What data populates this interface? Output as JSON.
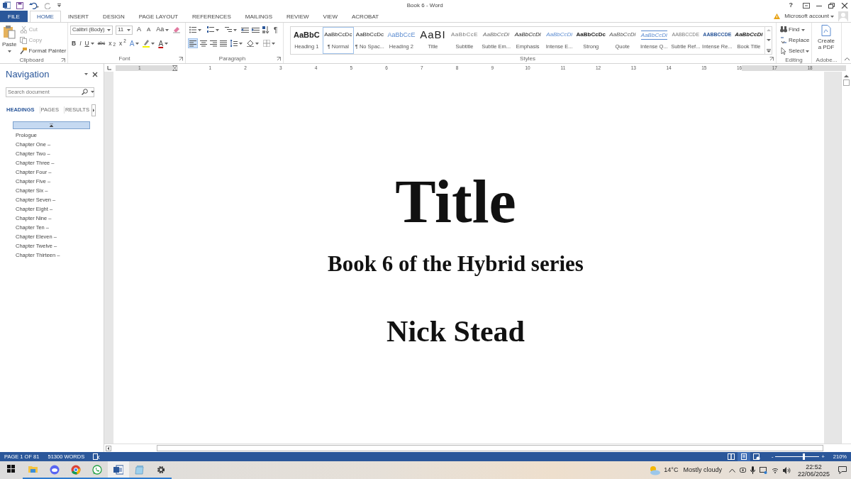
{
  "title_bar": {
    "title": "Book 6 - Word",
    "help": "?"
  },
  "account": {
    "label": "Microsoft account"
  },
  "tabs": [
    {
      "label": "FILE",
      "kind": "backstage",
      "selected": false
    },
    {
      "label": "HOME",
      "kind": "tab",
      "selected": true
    },
    {
      "label": "INSERT",
      "kind": "tab",
      "selected": false
    },
    {
      "label": "DESIGN",
      "kind": "tab",
      "selected": false
    },
    {
      "label": "PAGE LAYOUT",
      "kind": "tab",
      "selected": false
    },
    {
      "label": "REFERENCES",
      "kind": "tab",
      "selected": false
    },
    {
      "label": "MAILINGS",
      "kind": "tab",
      "selected": false
    },
    {
      "label": "REVIEW",
      "kind": "tab",
      "selected": false
    },
    {
      "label": "VIEW",
      "kind": "tab",
      "selected": false
    },
    {
      "label": "ACROBAT",
      "kind": "tab",
      "selected": false
    }
  ],
  "clipboard": {
    "paste": "Paste",
    "group": "Clipboard",
    "items": [
      {
        "kind": "cut",
        "label": "Cut",
        "disabled": true
      },
      {
        "kind": "copy",
        "label": "Copy",
        "disabled": true
      },
      {
        "kind": "painter",
        "label": "Format Painter",
        "disabled": false
      }
    ]
  },
  "font": {
    "name": "Calibri (Body)",
    "size": "11",
    "grow": "A",
    "shrink": "A",
    "case": "Aa",
    "format_buttons": [
      "B",
      "I",
      "U",
      "abc",
      "x$_{2}$",
      "x$^{2}$"
    ],
    "effects": "A",
    "font_color_label": "A",
    "group": "Font"
  },
  "paragraph": {
    "show_marks": "¶",
    "group": "Paragraph",
    "alignment": [
      {
        "kind": "left",
        "selected": true
      },
      {
        "kind": "center",
        "selected": false
      },
      {
        "kind": "right",
        "selected": false
      },
      {
        "kind": "justify",
        "selected": false
      }
    ]
  },
  "styles": {
    "group": "Styles",
    "items": [
      {
        "preview": "AaBbC",
        "label": "Heading 1",
        "kind": "heading1",
        "selected": false
      },
      {
        "preview": "AaBbCcDc",
        "label": "¶ Normal",
        "kind": "normal",
        "selected": true
      },
      {
        "preview": "AaBbCcDc",
        "label": "¶ No Spac...",
        "kind": "normal",
        "selected": false
      },
      {
        "preview": "AaBbCcE",
        "label": "Heading 2",
        "kind": "heading2",
        "selected": false
      },
      {
        "preview": "AaBI",
        "label": "Title",
        "kind": "title",
        "selected": false
      },
      {
        "preview": "AaBbCcE",
        "label": "Subtitle",
        "kind": "subtitle",
        "selected": false
      },
      {
        "preview": "AaBbCcDi",
        "label": "Subtle Em...",
        "kind": "subtle",
        "selected": false
      },
      {
        "preview": "AaBbCcDi",
        "label": "Emphasis",
        "kind": "emphasis",
        "selected": false
      },
      {
        "preview": "AaBbCcDi",
        "label": "Intense E...",
        "kind": "intense",
        "selected": false
      },
      {
        "preview": "AaBbCcDc",
        "label": "Strong",
        "kind": "strong",
        "selected": false
      },
      {
        "preview": "AaBbCcDi",
        "label": "Quote",
        "kind": "quote",
        "selected": false
      },
      {
        "preview": "AaBbCcDi",
        "label": "Intense Q...",
        "kind": "intensequote",
        "selected": false
      },
      {
        "preview": "AABBCCDE",
        "label": "Subtle Ref...",
        "kind": "subtleref",
        "selected": false
      },
      {
        "preview": "AABBCCDE",
        "label": "Intense Re...",
        "kind": "intenseref",
        "selected": false
      },
      {
        "preview": "AaBbCcDi",
        "label": "Book Title",
        "kind": "booktitle",
        "selected": false
      }
    ]
  },
  "editing": {
    "group": "Editing",
    "items": [
      {
        "kind": "find",
        "label": "Find"
      },
      {
        "kind": "replace",
        "label": "Replace"
      },
      {
        "kind": "select",
        "label": "Select"
      }
    ]
  },
  "adobe": {
    "label": "Create a PDF",
    "group": "Adobe..."
  },
  "ruler": {
    "left_numbers": [
      "1"
    ],
    "numbers": [
      "1",
      "2",
      "3",
      "4",
      "5",
      "6",
      "7",
      "8",
      "9",
      "10",
      "11",
      "12",
      "13",
      "14",
      "15",
      "16",
      "17",
      "18"
    ]
  },
  "navigation": {
    "title": "Navigation",
    "search_placeholder": "Search document",
    "tabs": [
      {
        "label": "HEADINGS",
        "selected": true
      },
      {
        "label": "PAGES",
        "selected": false
      },
      {
        "label": "RESULTS",
        "selected": false
      }
    ],
    "top_heading": {
      "selected": true
    },
    "headings": [
      "Prologue",
      "Chapter One –",
      "Chapter Two –",
      "Chapter Three –",
      "Chapter Four –",
      "Chapter Five –",
      "Chapter Six –",
      "Chapter Seven –",
      "Chapter Eight –",
      "Chapter Nine –",
      "Chapter Ten –",
      "Chapter Eleven –",
      "Chapter Twelve –",
      "Chapter Thirteen –"
    ]
  },
  "document": {
    "title": "Title",
    "subtitle": "Book 6 of the Hybrid series",
    "author": "Nick Stead"
  },
  "status_bar": {
    "page": "PAGE 1 OF 81",
    "words": "51300 WORDS",
    "views": [
      {
        "kind": "read",
        "selected": false
      },
      {
        "kind": "print",
        "selected": true
      },
      {
        "kind": "web",
        "selected": false
      }
    ],
    "zoom_out": "-",
    "zoom_in": "+",
    "zoom": {
      "level": 0.65
    },
    "zoom_reading": "210%"
  },
  "taskbar": {
    "apps": [
      {
        "kind": "start",
        "active": false
      },
      {
        "kind": "folder",
        "active": false
      },
      {
        "kind": "chat",
        "active": false
      },
      {
        "kind": "browser",
        "active": false
      },
      {
        "kind": "phone",
        "active": false
      },
      {
        "kind": "word",
        "active": true
      },
      {
        "kind": "notes",
        "active": false
      },
      {
        "kind": "gear",
        "active": false
      }
    ],
    "weather": {
      "temperature": "14°C",
      "condition": "Mostly cloudy"
    },
    "time": "22:52",
    "date": "22/06/2025"
  }
}
